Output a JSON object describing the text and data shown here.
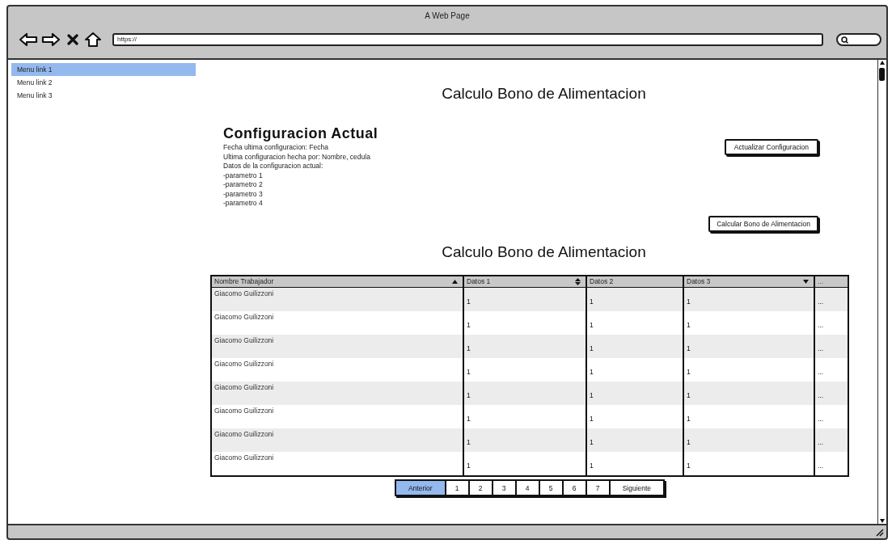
{
  "window": {
    "title": "A Web Page",
    "url": "https://"
  },
  "sidebar": {
    "items": [
      {
        "label": "Menu link 1",
        "selected": true
      },
      {
        "label": "Menu link 2",
        "selected": false
      },
      {
        "label": "Menu link 3",
        "selected": false
      }
    ]
  },
  "page_title": "Calculo Bono de Alimentacion",
  "config": {
    "heading": "Configuracion Actual",
    "lines": [
      "Fecha ultima configuracion: Fecha",
      "Ultima configuracion hecha por: Nombre, cedula",
      "Datos de la configuracion actual:",
      "-parametro 1",
      "-parametro 2",
      "-parametro 3",
      "-parametro 4"
    ],
    "buttons": [
      "Actualizar Configuracion",
      "Calcular Bono de Alimentacion"
    ]
  },
  "table_title": "Calculo Bono de Alimentacion",
  "table": {
    "columns": [
      {
        "label": "Nombre Trabajador",
        "sort_up": true,
        "sort_down": false
      },
      {
        "label": "Datos 1",
        "sort_up": true,
        "sort_down": true
      },
      {
        "label": "Datos 2",
        "sort_up": false,
        "sort_down": false
      },
      {
        "label": "Datos 3",
        "sort_up": false,
        "sort_down": true
      },
      {
        "label": "...",
        "sort_up": false,
        "sort_down": false
      }
    ],
    "rows": [
      [
        "Giacomo Guilizzoni",
        "1",
        "1",
        "1",
        "..."
      ],
      [
        "Giacomo Guilizzoni",
        "1",
        "1",
        "1",
        "..."
      ],
      [
        "Giacomo Guilizzoni",
        "1",
        "1",
        "1",
        "..."
      ],
      [
        "Giacomo Guilizzoni",
        "1",
        "1",
        "1",
        "..."
      ],
      [
        "Giacomo Guilizzoni",
        "1",
        "1",
        "1",
        "..."
      ],
      [
        "Giacomo Guilizzoni",
        "1",
        "1",
        "1",
        "..."
      ],
      [
        "Giacomo Guilizzoni",
        "1",
        "1",
        "1",
        "..."
      ],
      [
        "Giacomo Guilizzoni",
        "1",
        "1",
        "1",
        "..."
      ]
    ]
  },
  "pagination": {
    "pages": [
      {
        "label": "Anterior",
        "selected": true
      },
      {
        "label": "1",
        "selected": false
      },
      {
        "label": "2",
        "selected": false
      },
      {
        "label": "3",
        "selected": false
      },
      {
        "label": "4",
        "selected": false
      },
      {
        "label": "5",
        "selected": false
      },
      {
        "label": "6",
        "selected": false
      },
      {
        "label": "7",
        "selected": false
      },
      {
        "label": "Siguiente",
        "selected": false
      }
    ]
  }
}
